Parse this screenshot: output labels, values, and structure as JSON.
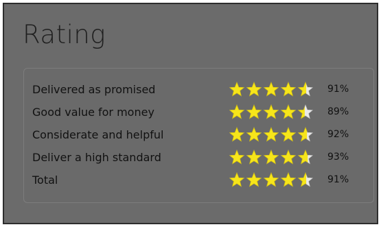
{
  "rating": {
    "title": "Rating",
    "rows": [
      {
        "label": "Delivered as promised",
        "percent_text": "91%",
        "stars_value": 4.55
      },
      {
        "label": "Good value for money",
        "percent_text": "89%",
        "stars_value": 4.45
      },
      {
        "label": "Considerate and helpful",
        "percent_text": "92%",
        "stars_value": 4.6
      },
      {
        "label": "Deliver a high standard",
        "percent_text": "93%",
        "stars_value": 4.65
      },
      {
        "label": "Total",
        "percent_text": "91%",
        "stars_value": 4.55
      }
    ],
    "stars_max": 5
  },
  "colors": {
    "panel_bg": "#6b6b6b",
    "star_fill": "#f6e51b",
    "star_empty": "#e9e9e9",
    "text": "#111111"
  },
  "icons": {
    "star": "star-icon"
  }
}
